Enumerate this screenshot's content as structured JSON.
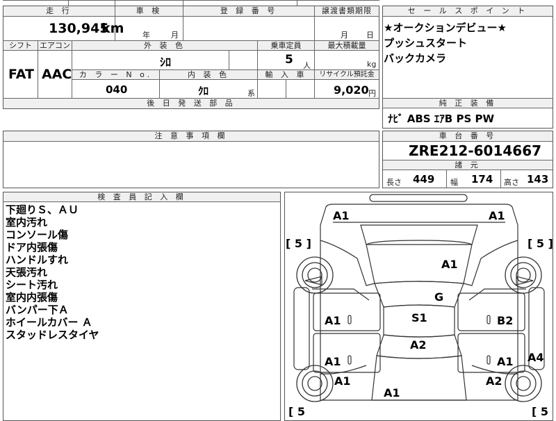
{
  "top_table": {
    "labels": {
      "mileage": "走 行",
      "shaken": "車 検",
      "reg_no": "登 録 番 号",
      "transfer_deadline": "譲渡書類期限",
      "shift": "シフト",
      "aircon": "エアコン",
      "ext_color": "外 装 色",
      "capacity": "乗車定員",
      "max_load": "最大積載量",
      "color_no": "カ ラ ー N o.",
      "int_color": "内 装 色",
      "import": "輸 入 車",
      "recycle": "リサイクル預託金",
      "later_parts": "後 日 発 送 部 品"
    },
    "mileage": "130,945",
    "mileage_unit": "km",
    "shaken_year": "年",
    "shaken_month": "月",
    "transfer_month": "月",
    "transfer_day": "日",
    "shift": "FAT",
    "aircon": "AAC",
    "ext_color": "ｼﾛ",
    "capacity": "5",
    "capacity_unit": "人",
    "max_load_unit": "kg",
    "color_no": "040",
    "int_color": "ｸﾛ",
    "int_color_suffix": "系",
    "recycle": "9,020",
    "recycle_unit": "円"
  },
  "sales_points": {
    "header": "セ ー ル ス ポ イ ン ト",
    "lines": [
      "★オークションデビュー★",
      "プッシュスタート",
      "バックカメラ"
    ]
  },
  "oem_equipment": {
    "header": "純 正 装 備",
    "value": "ﾅﾋﾞ ABS ｴｱB PS PW"
  },
  "caution": {
    "header": "注 意 事 項 欄"
  },
  "chassis": {
    "header": "車 台 番 号",
    "value": "ZRE212-6014667"
  },
  "specs": {
    "header": "諸 元",
    "length_label": "長さ",
    "length": "449",
    "width_label": "幅",
    "width": "174",
    "height_label": "高さ",
    "height": "143"
  },
  "inspector": {
    "header": "検 査 員 記 入 欄",
    "notes": [
      "下廻りＳ、ＡＵ",
      "室内汚れ",
      "コンソール傷",
      "ドア内張傷",
      "ハンドルすれ",
      "天張汚れ",
      "シート汚れ",
      "室内内張傷",
      "バンパー下Ａ",
      "ホイールカバー Ａ",
      "スタッドレスタイヤ"
    ]
  },
  "car_diagram": {
    "tires": {
      "front_left": "[ 5 ]",
      "front_right": "[ 5 ]",
      "rear_left": "[ 5",
      "rear_right": "[ 5"
    },
    "marks": {
      "front_left_corner": "A1",
      "front_right_corner": "A1",
      "hood": "A1",
      "windshield": "G",
      "roof": "S1",
      "trunk": "A2",
      "left_front_door": "A1",
      "left_rear_door": "A1",
      "left_rear_fender": "A1",
      "right_front_door": "B2",
      "right_rear_door": "A1",
      "right_rear_fender": "A2",
      "right_side_skirt": "A4",
      "rear_bumper": "A1"
    }
  }
}
